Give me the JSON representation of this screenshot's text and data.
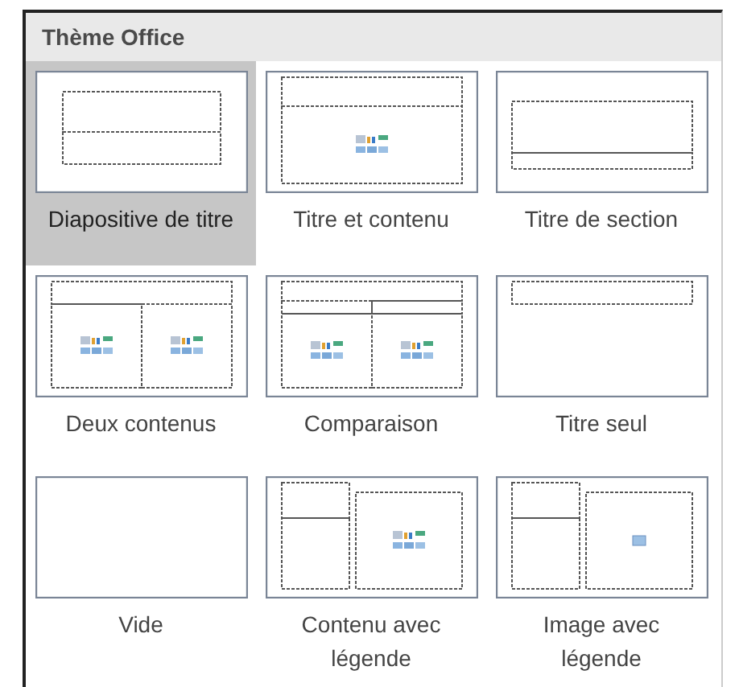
{
  "gallery": {
    "title": "Thème Office",
    "layouts": [
      {
        "kind": "title",
        "label": "Diapositive de titre",
        "selected": true
      },
      {
        "kind": "title-content",
        "label": "Titre et contenu",
        "selected": false
      },
      {
        "kind": "section",
        "label": "Titre de section",
        "selected": false
      },
      {
        "kind": "two-content",
        "label": "Deux contenus",
        "selected": false
      },
      {
        "kind": "comparison",
        "label": "Comparaison",
        "selected": false
      },
      {
        "kind": "title-only",
        "label": "Titre seul",
        "selected": false
      },
      {
        "kind": "blank",
        "label": "Vide",
        "selected": false
      },
      {
        "kind": "content-caption",
        "label": "Contenu avec\nlégende",
        "selected": false
      },
      {
        "kind": "picture-caption",
        "label": "Image avec\nlégende",
        "selected": false
      }
    ]
  }
}
